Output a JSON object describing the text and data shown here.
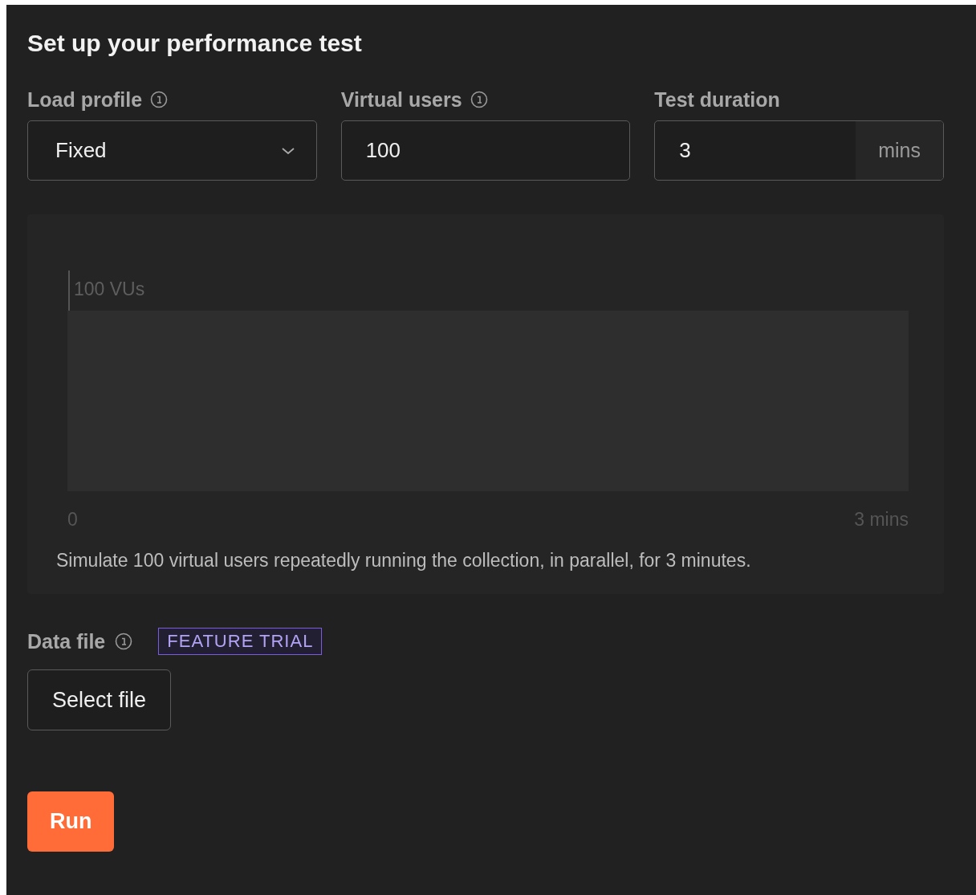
{
  "title": "Set up your performance test",
  "fields": [
    {
      "kind": "select",
      "label": "Load profile",
      "info": true,
      "value": "Fixed"
    },
    {
      "kind": "text",
      "label": "Virtual users",
      "info": true,
      "value": "100"
    },
    {
      "kind": "unit",
      "label": "Test duration",
      "info": false,
      "value": "3",
      "unit": "mins"
    }
  ],
  "load_graph": {
    "y_label": "100 VUs",
    "x_start": "0",
    "x_end": "3 mins",
    "caption": "Simulate 100 virtual users repeatedly running the collection, in parallel, for 3 minutes."
  },
  "data_file": {
    "label": "Data file",
    "info": true,
    "badge": "FEATURE TRIAL",
    "button": "Select file"
  },
  "run_button": "Run"
}
